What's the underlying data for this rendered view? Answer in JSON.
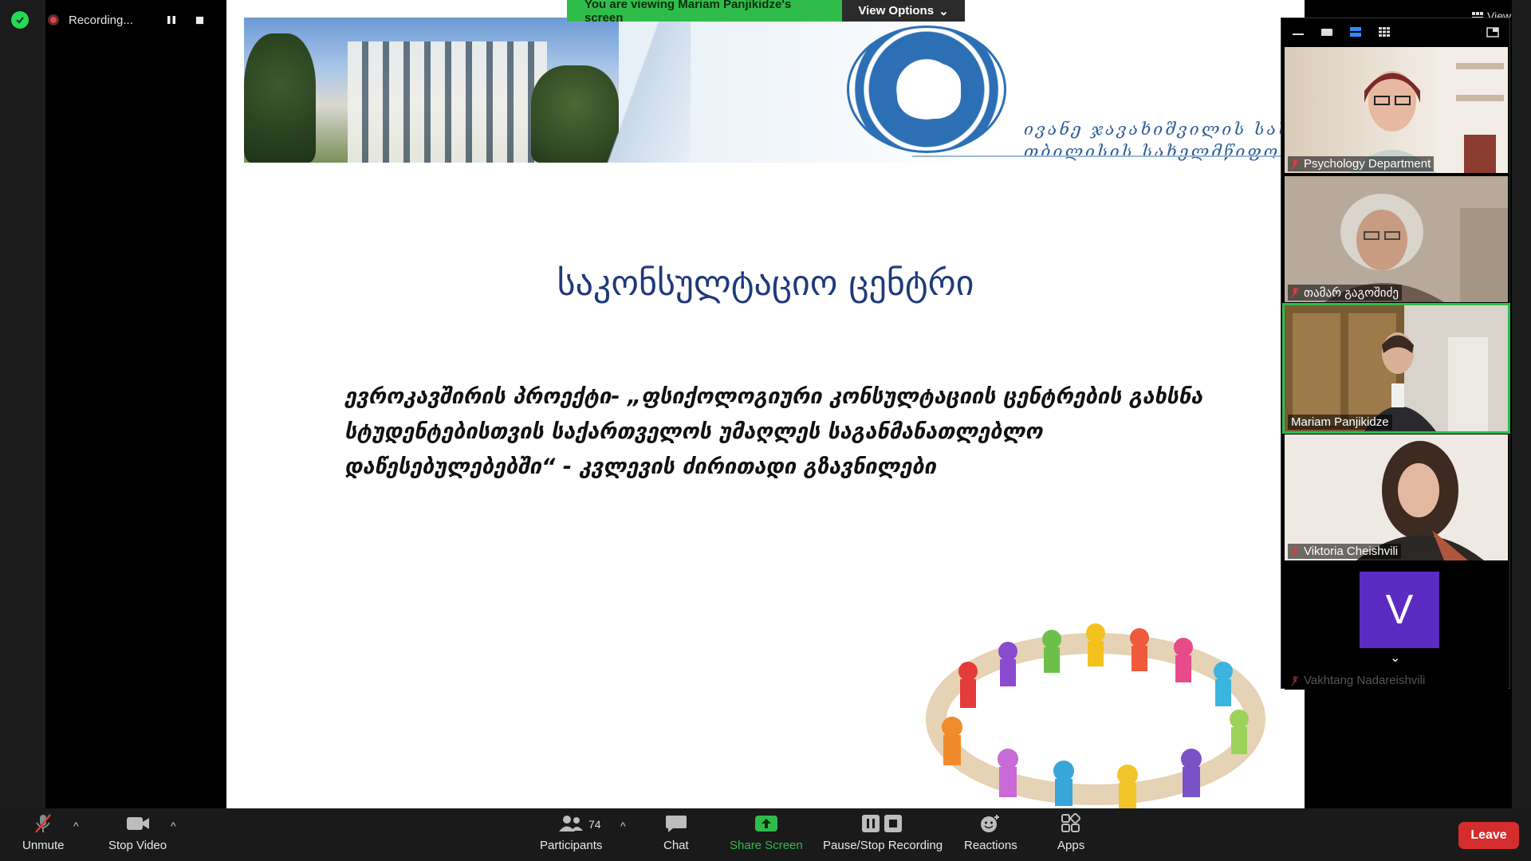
{
  "recording": {
    "label": "Recording..."
  },
  "viewing": {
    "banner_text": "You are viewing Mariam Panjikidze's screen",
    "options_label": "View Options"
  },
  "gallery": {
    "view_label": "View",
    "participants": [
      {
        "name": "Psychology Department",
        "muted": true
      },
      {
        "name": "თამარ გაგოშიძე",
        "muted": true
      },
      {
        "name": "Mariam Panjikidze",
        "muted": false,
        "active_speaker": true
      },
      {
        "name": "Viktoria Cheishvili",
        "muted": true
      },
      {
        "name": "Vakhtang Nadareishvili",
        "muted": true,
        "avatar_letter": "V",
        "avatar_color": "#5b2bc2"
      }
    ]
  },
  "slide": {
    "banner_text_line1": "ივანე ჯავახიშვილის სახელობის",
    "banner_text_line2": "თბილისის სახელმწიფო უნივერსიტეტი",
    "title": "საკონსულტაციო ცენტრი",
    "body": "ევროკავშირის პროექტი- „ფსიქოლოგიური კონსულტაციის ცენტრების გახსნა სტუდენტებისთვის საქართველოს უმაღლეს საგანმანათლებლო დაწესებულებებში“ - კვლევის ძირითადი გზავნილები"
  },
  "toolbar": {
    "unmute": "Unmute",
    "stop_video": "Stop Video",
    "participants": "Participants",
    "participants_count": "74",
    "chat": "Chat",
    "share_screen": "Share Screen",
    "pause_stop_recording": "Pause/Stop Recording",
    "reactions": "Reactions",
    "apps": "Apps",
    "leave": "Leave"
  },
  "colors": {
    "share_green": "#2fbc4b",
    "leave_red": "#d42d2d",
    "title_blue": "#1f3a7a"
  }
}
